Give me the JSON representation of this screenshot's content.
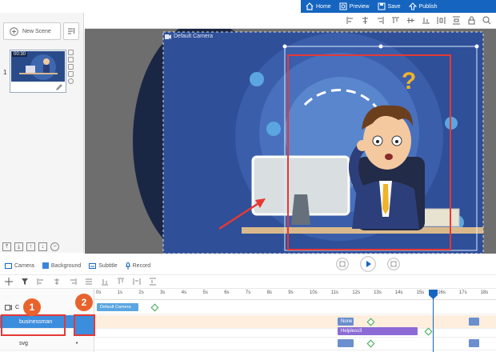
{
  "topbar": {
    "home_label": "Home",
    "preview_label": "Preview",
    "save_label": "Save",
    "publish_label": "Publish"
  },
  "left_panel": {
    "new_scene_label": "New Scene",
    "scene_number": "1",
    "scene_time": "00:30"
  },
  "canvas": {
    "camera_label": "Default Camera"
  },
  "panel_tabs": {
    "camera": "Camera",
    "background": "Background",
    "subtitle": "Subtitle",
    "record": "Record"
  },
  "timeline": {
    "ruler_ticks": [
      "0s",
      "1s",
      "2s",
      "3s",
      "4s",
      "5s",
      "6s",
      "7s",
      "8s",
      "9s",
      "10s",
      "11s",
      "12s",
      "13s",
      "14s",
      "15s",
      "16s",
      "17s",
      "18s"
    ],
    "rows": [
      {
        "label": "C",
        "track_clip": "Default Camera"
      },
      {
        "label": "businessman",
        "track_clips": [
          "None",
          "Helpless3"
        ]
      },
      {
        "label": "svg"
      }
    ]
  },
  "callouts": [
    "1",
    "2"
  ],
  "colors": {
    "topbar": "#1565c0",
    "accent_blue": "#1565c0",
    "selection_red": "#e53935",
    "callout_orange": "#e8622c",
    "keyframe_green": "#37a651",
    "clip_purple": "#8c6bd6"
  }
}
